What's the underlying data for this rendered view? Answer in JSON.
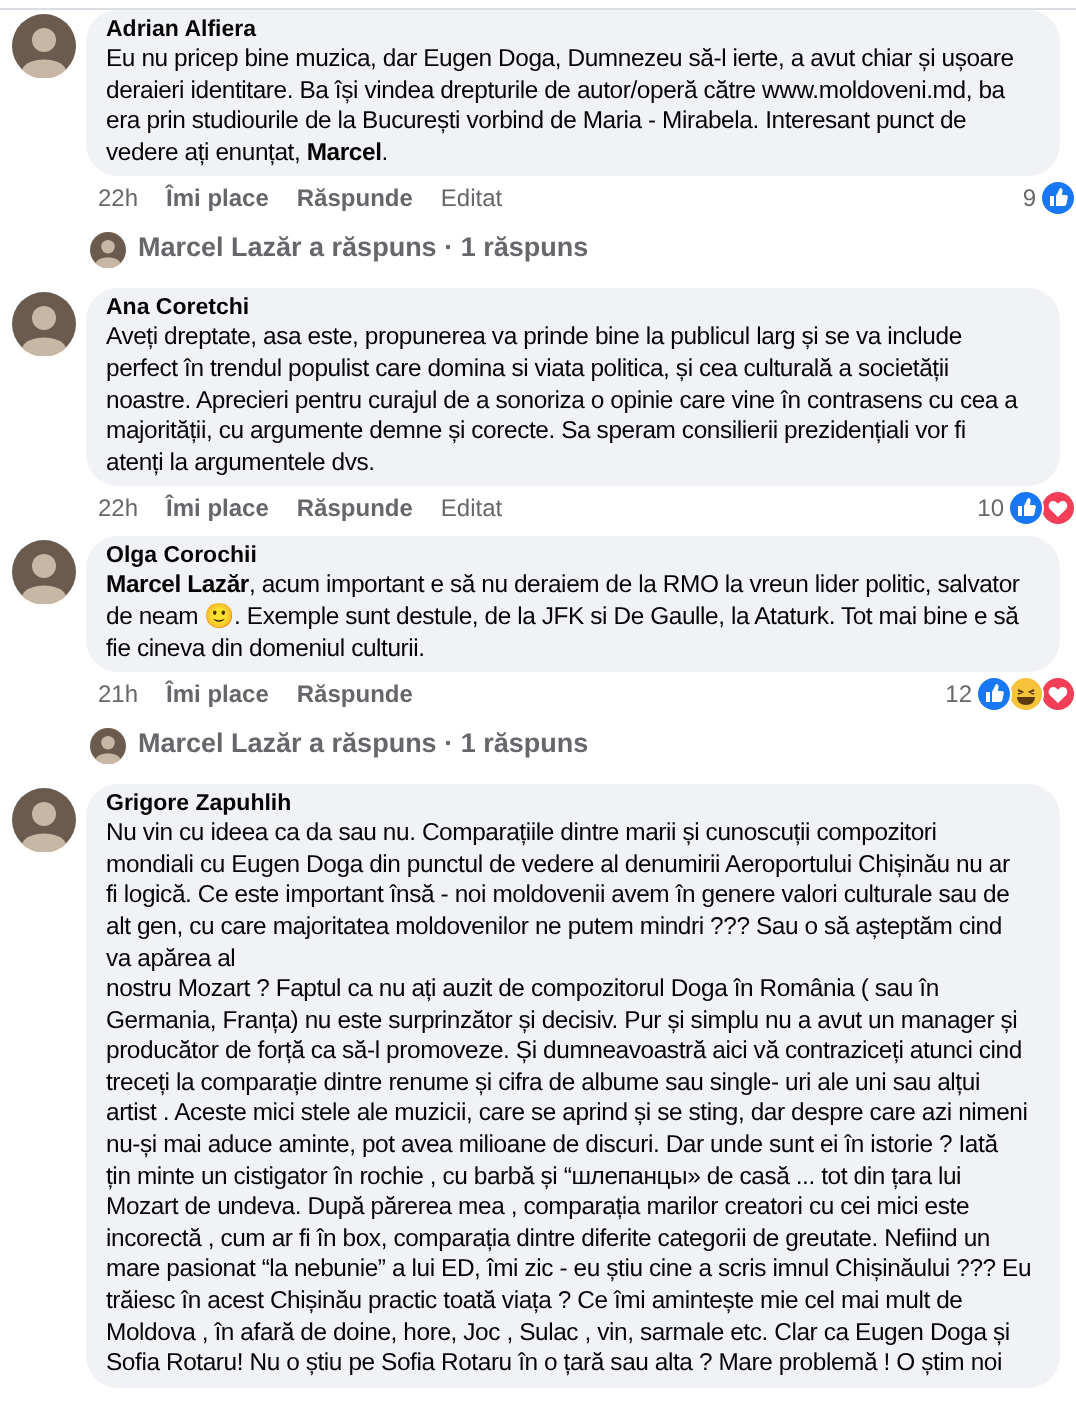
{
  "comments": [
    {
      "author": "Adrian Alfiera",
      "text": "Eu nu pricep bine muzica, dar Eugen Doga, Dumnezeu să-l ierte, a avut chiar și ușoare\nderaieri identitare. Ba își vindea drepturile de autor/operă către www.moldoveni.md, ba\nera prin studiourile de la București vorbind de Maria - Mirabela. Interesant punct de\nvedere ați enunțat, **Marcel**.",
      "time": "22h",
      "like_label": "Îmi place",
      "reply_label": "Răspunde",
      "edited": "Editat",
      "reaction_count": "9",
      "reactions": [
        {
          "kind": "like"
        }
      ],
      "reply_summary": "Marcel Lazăr a răspuns · 1 răspuns"
    },
    {
      "author": "Ana Coretchi",
      "text": "Aveți dreptate, asa este, propunerea va prinde bine la publicul larg și se va include\nperfect în trendul populist care domina si viata politica, și cea culturală a societății\nnoastre. Aprecieri pentru curajul de a sonoriza o opinie care vine în contrasens cu cea a\nmajorității, cu argumente demne și corecte. Sa speram consilierii prezidențiali vor fi\natenți la argumentele dvs.",
      "time": "22h",
      "like_label": "Îmi place",
      "reply_label": "Răspunde",
      "edited": "Editat",
      "reaction_count": "10",
      "reactions": [
        {
          "kind": "like"
        },
        {
          "kind": "love"
        }
      ]
    },
    {
      "author": "Olga Corochii",
      "text": "**Marcel Lazăr**, acum important e să nu deraiem de la RMO la vreun lider politic, salvator\nde neam 🙂. Exemple sunt destule, de la JFK si De Gaulle, la Ataturk. Tot mai bine e să\nfie cineva din domeniul culturii.",
      "time": "21h",
      "like_label": "Îmi place",
      "reply_label": "Răspunde",
      "reaction_count": "12",
      "reactions": [
        {
          "kind": "like"
        },
        {
          "kind": "haha"
        },
        {
          "kind": "love"
        }
      ],
      "reply_summary": "Marcel Lazăr a răspuns · 1 răspuns"
    },
    {
      "author": "Grigore Zapuhlih",
      "text": "Nu vin cu ideea ca da sau nu. Comparațiile dintre marii și cunoscuții compozitori\nmondiali cu Eugen Doga din punctul de vedere al denumirii Aeroportului Chișinău nu ar\nfi logică. Ce este important însă - noi moldovenii avem în genere valori culturale sau de\nalt gen, cu care majoritatea moldovenilor ne putem mindri ??? Sau o să așteptăm cind\nva apărea al\nnostru Mozart ? Faptul ca nu ați auzit de compozitorul Doga în România ( sau în\nGermania, Franța) nu este surprinzător și decisiv. Pur și simplu nu a avut un manager și\nproducător de forță ca să-l promoveze. Și dumneavoastră aici vă contraziceți atunci cind\ntreceți la comparație dintre renume și cifra de albume sau single- uri ale uni sau alțui\nartist . Aceste mici stele ale muzicii, care se aprind și se sting, dar despre care azi nimeni\nnu-și mai aduce aminte, pot avea milioane de discuri. Dar unde sunt ei în istorie ? Iată\nțin minte un cistigator în rochie , cu barbă și “шлепанцы» de casă ... tot din țara lui\nMozart de undeva. După părerea mea , comparația marilor creatori cu cei mici este\nincorectă , cum ar fi în box, comparația dintre diferite categorii de greutate. Nefiind un\nmare pasionat “la nebunie” a lui ED, îmi zic - eu știu cine a scris imnul Chișinăului ??? Eu\ntrăiesc în acest Chișinău practic toată viața ? Ce îmi amintește mie cel mai mult de\nMoldova , în afară de doine, hore, Joc , Sulac , vin, sarmale etc. Clar ca Eugen Doga și\nSofia Rotaru! Nu o știu pe Sofia Rotaru în o țară sau alta ? Mare problemă ! O știm noi"
    }
  ]
}
